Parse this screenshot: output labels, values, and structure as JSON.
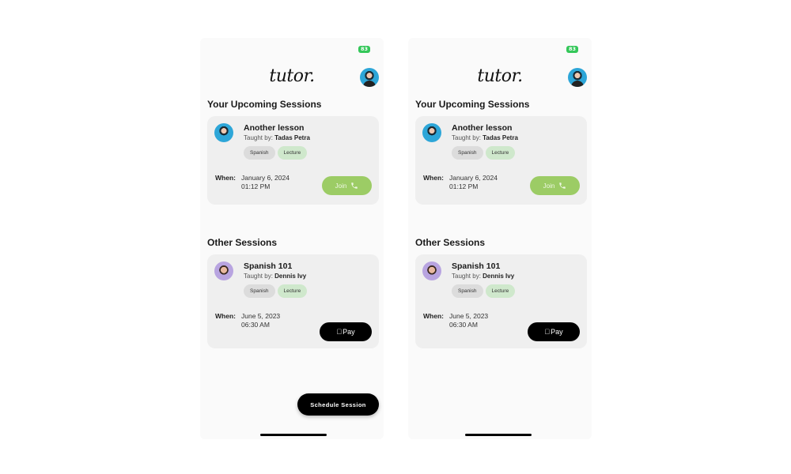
{
  "screens": [
    {
      "status_bar": {
        "battery": "83"
      },
      "header": {
        "logo": "tutor.",
        "profile_avatar": "profile-avatar"
      },
      "upcoming": {
        "title": "Your Upcoming Sessions",
        "card": {
          "title": "Another lesson",
          "taught_by_label": "Taught by:",
          "teacher": "Tadas Petra",
          "tags": [
            "Spanish",
            "Lecture"
          ],
          "when_label": "When:",
          "date": "January 6, 2024",
          "time": "01:12 PM",
          "action_label": "Join",
          "action_icon": "phone-icon",
          "action_color": "#9ccc65"
        }
      },
      "other": {
        "title": "Other Sessions",
        "card": {
          "title": "Spanish 101",
          "taught_by_label": "Taught by:",
          "teacher": "Dennis Ivy",
          "tags": [
            "Spanish",
            "Lecture"
          ],
          "when_label": "When:",
          "date": "June 5, 2023",
          "time": "06:30 AM",
          "action_label": "Pay",
          "action_icon": "apple-icon"
        }
      },
      "fab": {
        "label": "Schedule Session"
      }
    },
    {
      "status_bar": {
        "battery": "83"
      },
      "header": {
        "logo": "tutor.",
        "profile_avatar": "profile-avatar"
      },
      "upcoming": {
        "title": "Your Upcoming Sessions",
        "card": {
          "title": "Another lesson",
          "taught_by_label": "Taught by:",
          "teacher": "Tadas Petra",
          "tags": [
            "Spanish",
            "Lecture"
          ],
          "when_label": "When:",
          "date": "January 6, 2024",
          "time": "01:12 PM",
          "action_label": "Join",
          "action_icon": "phone-icon",
          "action_color": "#9ccc65"
        }
      },
      "other": {
        "title": "Other Sessions",
        "card": {
          "title": "Spanish 101",
          "taught_by_label": "Taught by:",
          "teacher": "Dennis Ivy",
          "tags": [
            "Spanish",
            "Lecture"
          ],
          "when_label": "When:",
          "date": "June 5, 2023",
          "time": "06:30 AM",
          "action_label": "Pay",
          "action_icon": "apple-icon"
        }
      }
    }
  ]
}
